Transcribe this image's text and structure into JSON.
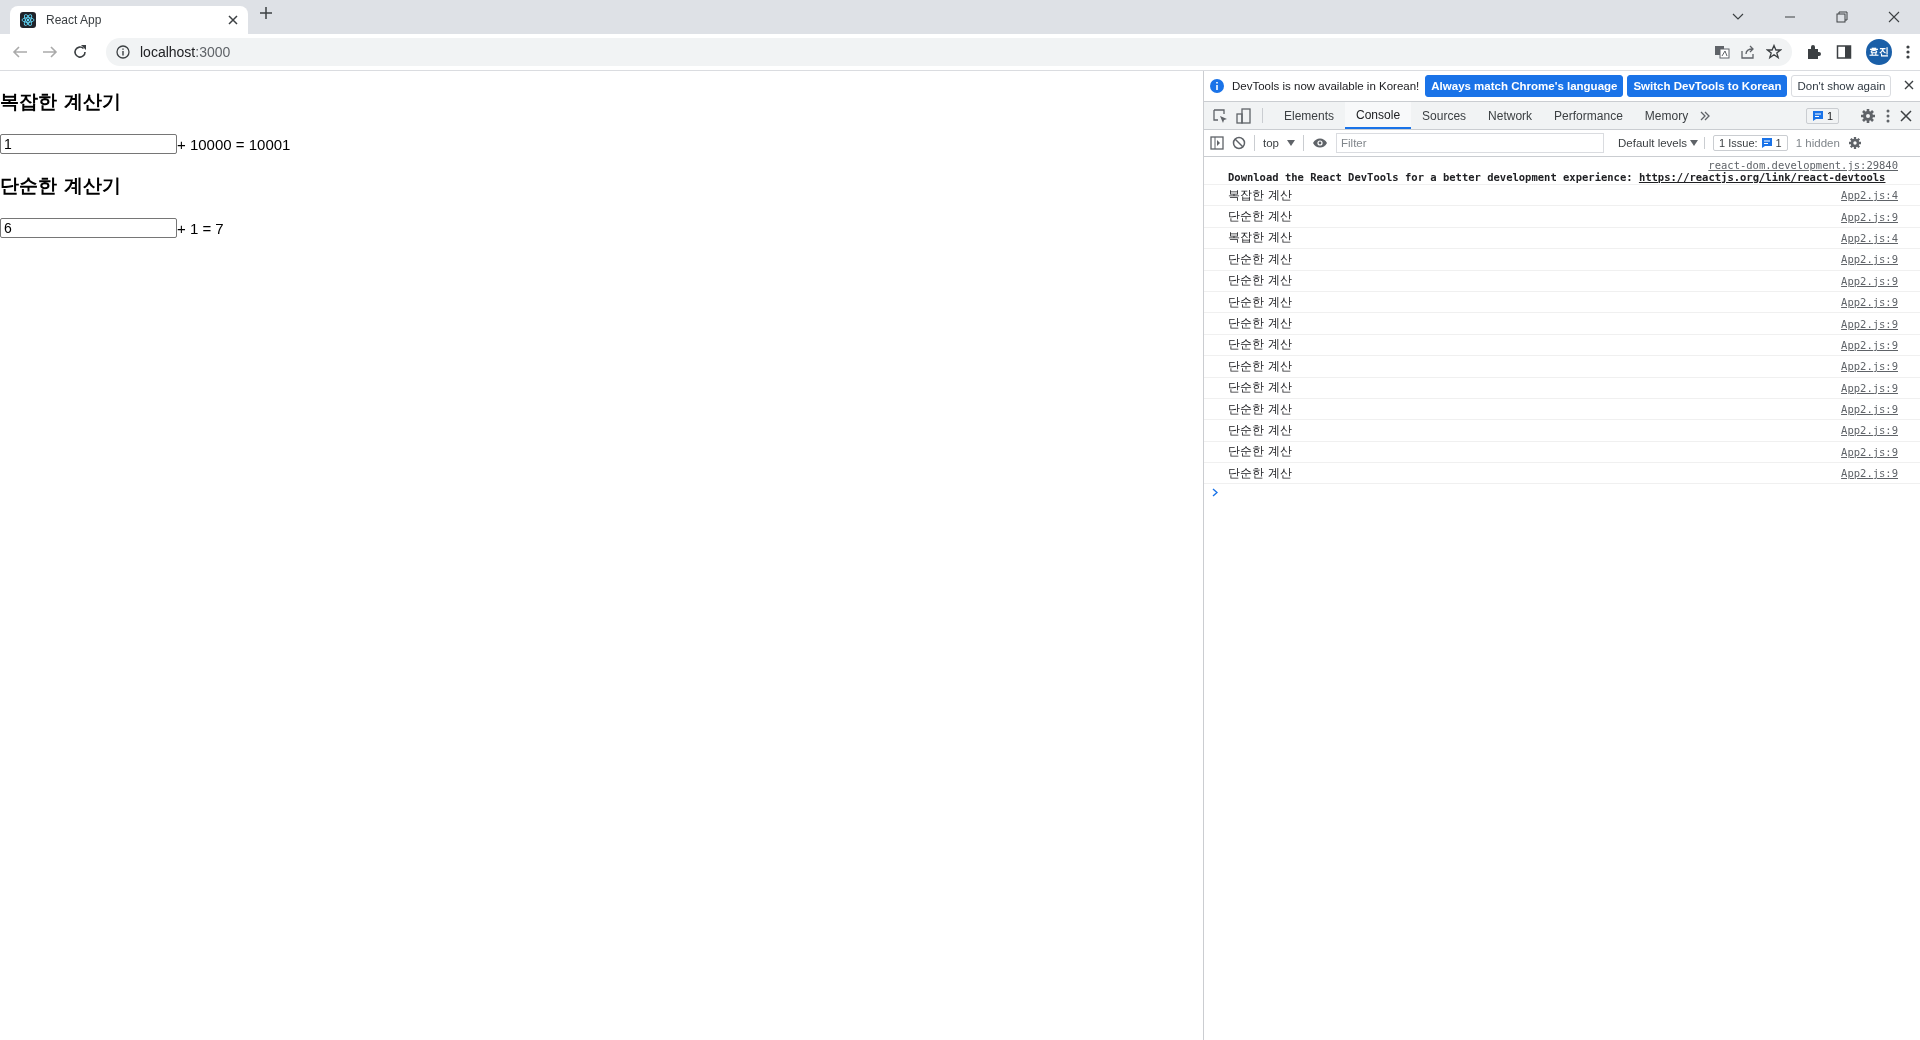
{
  "browser": {
    "tab": {
      "title": "React App"
    },
    "address": {
      "host": "localhost",
      "port": ":3000"
    },
    "profile": {
      "initials": "효진"
    }
  },
  "page": {
    "sections": [
      {
        "heading": "복잡한 계산기",
        "value": "1",
        "expression": "+ 10000 = 10001"
      },
      {
        "heading": "단순한 계산기",
        "value": "6",
        "expression": "+ 1 = 7"
      }
    ]
  },
  "devtools": {
    "infobar": {
      "message": "DevTools is now available in Korean!",
      "buttons": [
        {
          "label": "Always match Chrome's language",
          "kind": "primary"
        },
        {
          "label": "Switch DevTools to Korean",
          "kind": "primary"
        },
        {
          "label": "Don't show again",
          "kind": "secondary"
        }
      ]
    },
    "tabs": [
      {
        "label": "Elements",
        "selected": false
      },
      {
        "label": "Console",
        "selected": true
      },
      {
        "label": "Sources",
        "selected": false
      },
      {
        "label": "Network",
        "selected": false
      },
      {
        "label": "Performance",
        "selected": false
      },
      {
        "label": "Memory",
        "selected": false
      }
    ],
    "message_count": "1",
    "console_toolbar": {
      "context": "top",
      "filter_placeholder": "Filter",
      "levels": "Default levels",
      "issues": "1 Issue:",
      "issue_count": "1",
      "hidden": "1 hidden"
    },
    "messages": [
      {
        "kind": "long",
        "text": "Download the React DevTools for a better development experience: ",
        "link": "https://reactjs.org/link/react-devtools",
        "source": "react-dom.development.js:29840"
      },
      {
        "kind": "log",
        "text": "복잡한 계산",
        "source": "App2.js:4"
      },
      {
        "kind": "log",
        "text": "단순한 계산",
        "source": "App2.js:9"
      },
      {
        "kind": "log",
        "text": "복잡한 계산",
        "source": "App2.js:4"
      },
      {
        "kind": "log",
        "text": "단순한 계산",
        "source": "App2.js:9"
      },
      {
        "kind": "log",
        "text": "단순한 계산",
        "source": "App2.js:9"
      },
      {
        "kind": "log",
        "text": "단순한 계산",
        "source": "App2.js:9"
      },
      {
        "kind": "log",
        "text": "단순한 계산",
        "source": "App2.js:9"
      },
      {
        "kind": "log",
        "text": "단순한 계산",
        "source": "App2.js:9"
      },
      {
        "kind": "log",
        "text": "단순한 계산",
        "source": "App2.js:9"
      },
      {
        "kind": "log",
        "text": "단순한 계산",
        "source": "App2.js:9"
      },
      {
        "kind": "log",
        "text": "단순한 계산",
        "source": "App2.js:9"
      },
      {
        "kind": "log",
        "text": "단순한 계산",
        "source": "App2.js:9"
      },
      {
        "kind": "log",
        "text": "단순한 계산",
        "source": "App2.js:9"
      },
      {
        "kind": "log",
        "text": "단순한 계산",
        "source": "App2.js:9"
      }
    ]
  }
}
